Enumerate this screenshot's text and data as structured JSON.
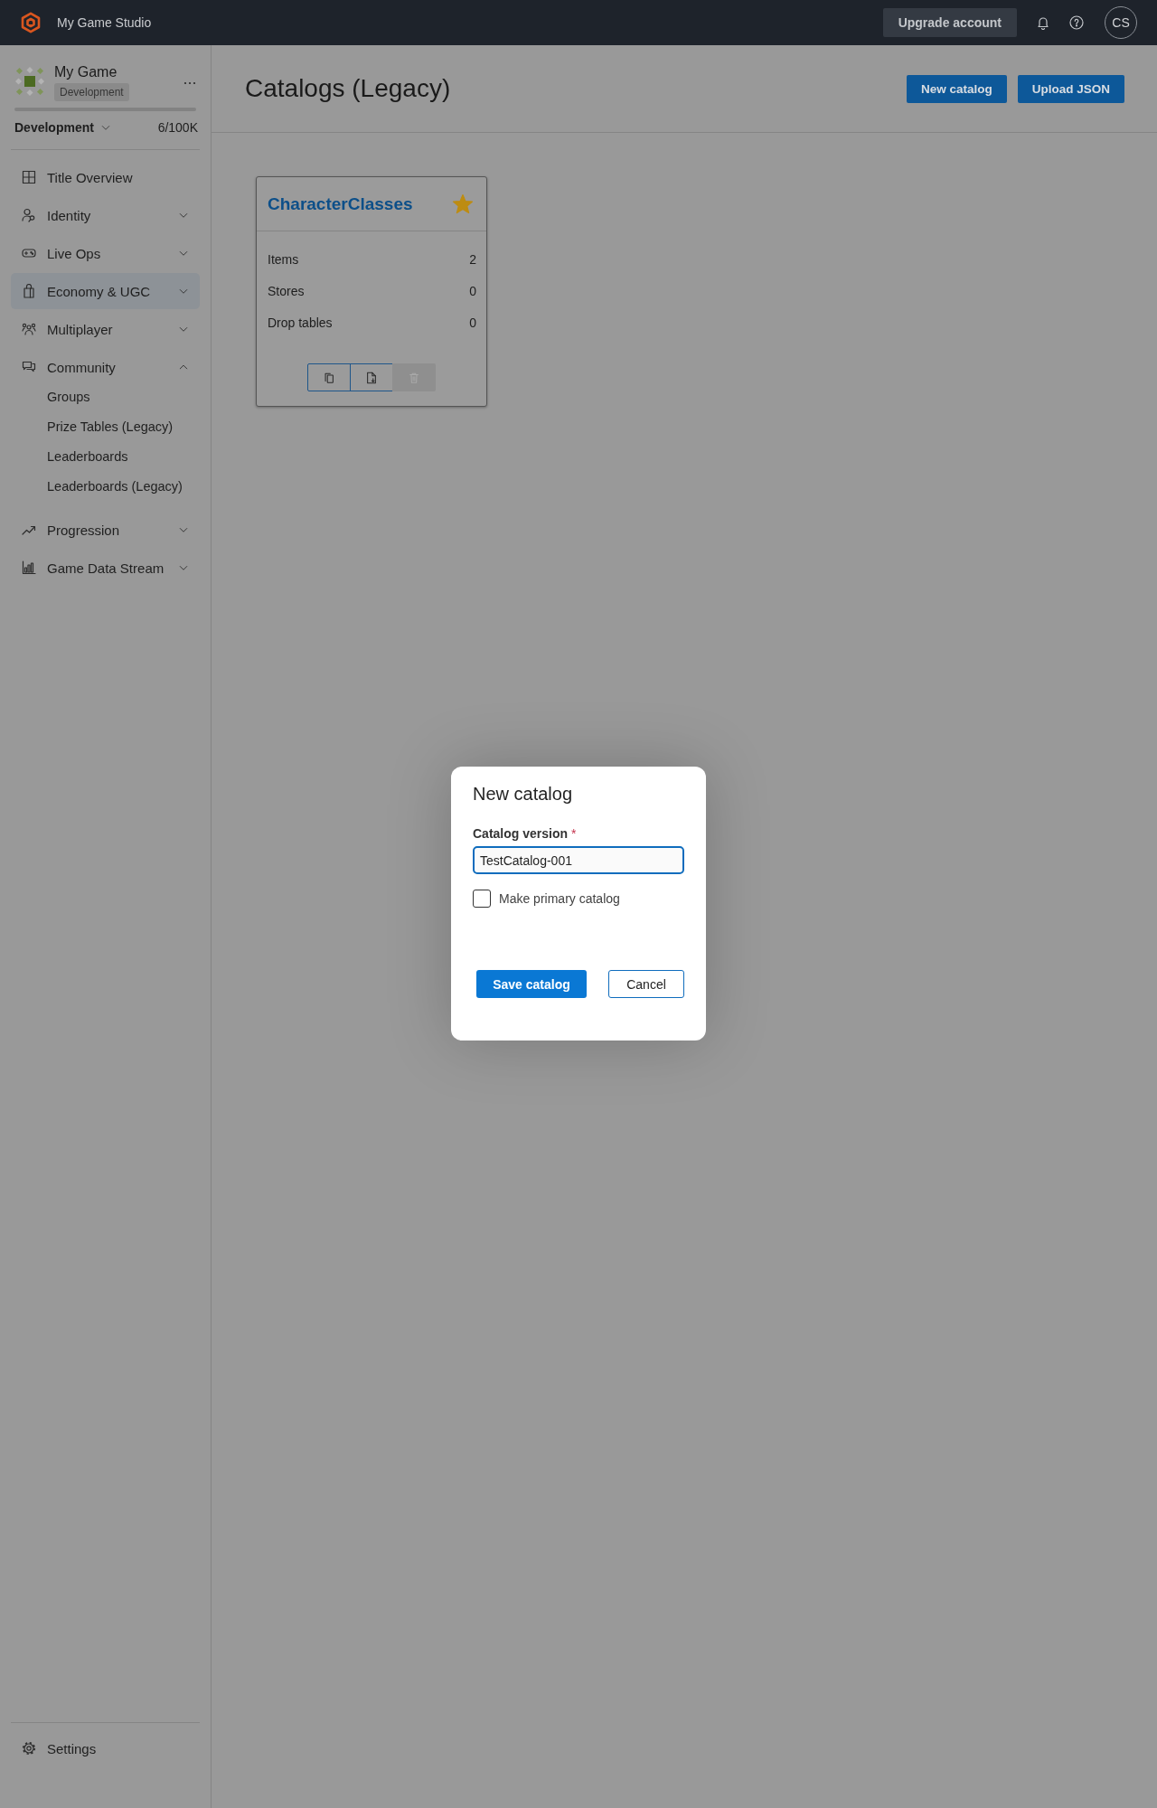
{
  "top_bar": {
    "title": "My Game Studio",
    "upgrade_button": "Upgrade account",
    "avatar": "CS"
  },
  "sidebar": {
    "game": {
      "name": "My Game",
      "badge": "Development"
    },
    "usage": {
      "environment": "Development",
      "count": "6/100K"
    },
    "nav": [
      {
        "kind": "link",
        "label": "Title Overview",
        "selected": false
      },
      {
        "kind": "group",
        "label": "Identity",
        "selected": false,
        "expanded": false
      },
      {
        "kind": "group",
        "label": "Live Ops",
        "selected": false,
        "expanded": false
      },
      {
        "kind": "group",
        "label": "Economy & UGC",
        "selected": true,
        "expanded": false
      },
      {
        "kind": "group",
        "label": "Multiplayer",
        "selected": false,
        "expanded": false
      },
      {
        "kind": "group",
        "label": "Community",
        "selected": false,
        "expanded": true,
        "children": [
          {
            "label": "Groups",
            "selected": false
          },
          {
            "label": "Prize Tables (Legacy)",
            "selected": false
          },
          {
            "label": "Leaderboards",
            "selected": false
          },
          {
            "label": "Leaderboards (Legacy)",
            "selected": false
          }
        ]
      },
      {
        "kind": "group",
        "label": "Progression",
        "selected": false,
        "expanded": false
      },
      {
        "kind": "group",
        "label": "Game Data Stream",
        "selected": false,
        "expanded": false
      }
    ],
    "footer": {
      "label": "Settings",
      "selected": false
    }
  },
  "page": {
    "title": "Catalogs (Legacy)",
    "actions": [
      "New catalog",
      "Upload JSON"
    ]
  },
  "catalogs": [
    {
      "name": "CharacterClasses",
      "primary": true,
      "stats": [
        {
          "label": "Items",
          "value": "2"
        },
        {
          "label": "Stores",
          "value": "0"
        },
        {
          "label": "Drop tables",
          "value": "0"
        }
      ],
      "actions": [
        {
          "kind": "copy",
          "disabled": false
        },
        {
          "kind": "export",
          "disabled": false
        },
        {
          "kind": "delete",
          "disabled": true
        }
      ]
    }
  ],
  "dialog": {
    "title": "New catalog",
    "field": {
      "label": "Catalog version",
      "required_mark": "*",
      "value": "TestCatalog-001",
      "focused": true
    },
    "checkbox": {
      "label": "Make primary catalog",
      "checked": false
    },
    "buttons": [
      {
        "kind": "primary",
        "label": "Save catalog"
      },
      {
        "kind": "secondary",
        "label": "Cancel"
      }
    ]
  }
}
